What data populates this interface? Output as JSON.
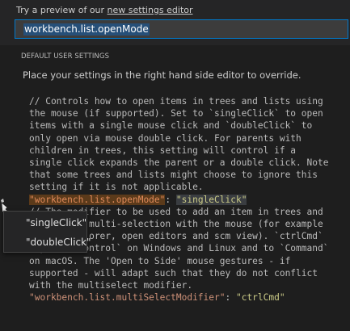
{
  "header": {
    "preview_prefix": "Try a preview of our ",
    "preview_link": "new settings editor",
    "search_value": "workbench.list.openMode"
  },
  "section": {
    "title": "DEFAULT USER SETTINGS",
    "info": "Place your settings in the right hand side editor to override."
  },
  "editor": {
    "comment1": [
      "// Controls how to open items in trees and lists using",
      "the mouse (if supported). Set to `singleClick` to open",
      "items with a single mouse click and `doubleClick` to",
      "only open via mouse double click. For parents with",
      "children in trees, this setting will control if a",
      "single click expands the parent or a double click. Note",
      "that some trees and lists might choose to ignore this",
      "setting if it is not applicable."
    ],
    "setting1_key": "\"workbench.list.openMode\"",
    "setting1_value": "\"singleClick\"",
    "comment2": [
      "// The modifier to be used to add an item in trees and",
      "lists to a multi-selection with the mouse (for example",
      "in the explorer, open editors and scm view). `ctrlCmd`",
      "maps to `Control` on Windows and Linux and to `Command`",
      "on macOS. The 'Open to Side' mouse gestures - if",
      "supported - will adapt such that they do not conflict",
      "with the multiselect modifier."
    ],
    "setting2_key": "\"workbench.list.multiSelectModifier\"",
    "setting2_value": "\"ctrlCmd\""
  },
  "menu": {
    "items": [
      "\"singleClick\"",
      "\"doubleClick\""
    ]
  },
  "colors": {
    "background": "#1e1e1e",
    "accent": "#007acc",
    "string_key": "#ce9178",
    "string_value": "#cccc88"
  }
}
